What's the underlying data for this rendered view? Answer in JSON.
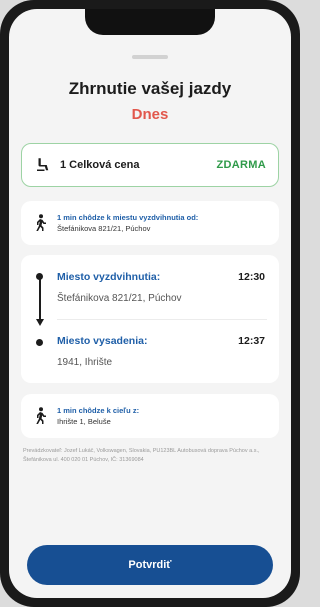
{
  "header": {
    "title": "Zhrnutie vašej jazdy",
    "day": "Dnes"
  },
  "price": {
    "label": "1 Celková cena",
    "value": "ZDARMA"
  },
  "walk_to_pickup": {
    "title": "1 min chôdze k miestu vyzdvihnutia od:",
    "address": "Štefánikova 821/21, Púchov"
  },
  "route": {
    "pickup_label": "Miesto vyzdvihnutia:",
    "pickup_time": "12:30",
    "pickup_address": "Štefánikova 821/21, Púchov",
    "dropoff_label": "Miesto vysadenia:",
    "dropoff_time": "12:37",
    "dropoff_address": "1941, Ihrište"
  },
  "walk_to_destination": {
    "title": "1 min chôdze k cieľu z:",
    "address": "Ihrište 1, Beluše"
  },
  "footer_note": "Prevádzkovateľ: Jozef Lukáč, Volkswagen, Slovakia, PU123BL Autobusová doprava Púchov a.s., Štefánikova ul. 400 020 01 Púchov, IČ: 31369084",
  "actions": {
    "confirm_label": "Potvrdiť"
  },
  "colors": {
    "accent_blue": "#174f93",
    "link_blue": "#1f5fa8",
    "today_red": "#e2574c",
    "free_green": "#2f9a49",
    "card_border_green": "#9dd3a4"
  },
  "icons": {
    "seat": "seat-icon",
    "walk": "walking-person-icon",
    "route_arrow": "route-arrow-icon"
  }
}
